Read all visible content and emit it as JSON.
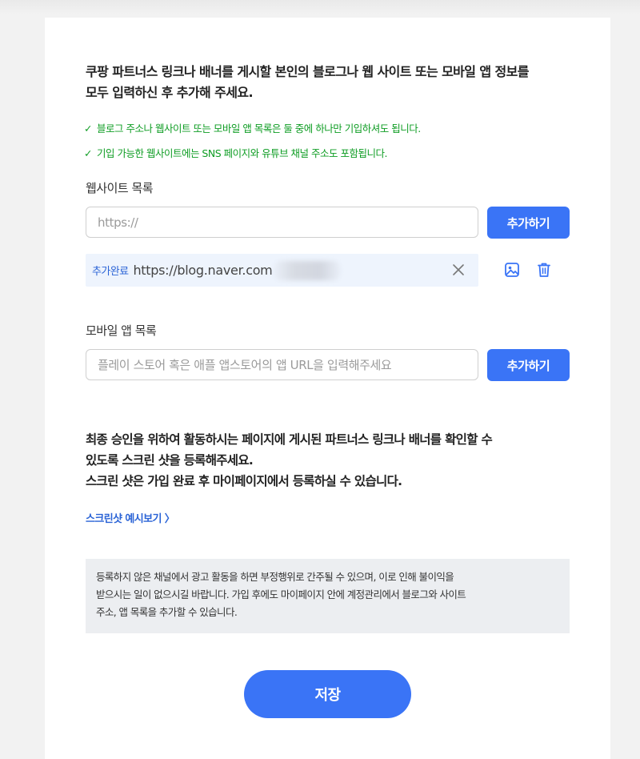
{
  "intro": {
    "line1": "쿠팡 파트너스 링크나 배너를 게시할 본인의 블로그나 웹 사이트 또는 모바일 앱 정보를",
    "line2": "모두 입력하신 후 추가해 주세요."
  },
  "checks": [
    {
      "mark": "✓",
      "text": "블로그 주소나 웹사이트 또는 모바일 앱 목록은 둘 중에 하나만 기입하셔도 됩니다."
    },
    {
      "mark": "✓",
      "text": "기입 가능한 웹사이트에는 SNS 페이지와 유튜브 채널 주소도 포함됩니다."
    }
  ],
  "website": {
    "label": "웹사이트 목록",
    "input_value": "",
    "placeholder": "https://",
    "add_label": "추가하기",
    "added_items": [
      {
        "tag": "추가완료",
        "url": "https://blog.naver.com"
      }
    ]
  },
  "mobile_app": {
    "label": "모바일 앱 목록",
    "input_value": "",
    "placeholder": "플레이 스토어 혹은 애플 앱스토어의 앱 URL을 입력해주세요",
    "add_label": "추가하기"
  },
  "guide": {
    "line1": "최종 승인을 위하여 활동하시는 페이지에 게시된 파트너스 링크나 배너를 확인할 수",
    "line2": "있도록 스크린 샷을 등록해주세요.",
    "line3": "스크린 샷은 가입 완료 후 마이페이지에서 등록하실 수 있습니다.",
    "preview_link": "스크린샷 예시보기 〉"
  },
  "notice": {
    "line1": "등록하지 않은 채널에서 광고 활동을 하면 부정행위로 간주될 수 있으며, 이로 인해 불이익을",
    "line2": "받으시는 일이 없으시길 바랍니다. 가입 후에도 마이페이지 안에 계정관리에서 블로그와 사이트",
    "line3": "주소, 앱 목록을 추가할 수 있습니다."
  },
  "save_label": "저장",
  "colors": {
    "accent": "#3a74f6",
    "check_green": "#0f9d24",
    "link_blue": "#2a63d6",
    "notice_bg": "#eceef1",
    "added_bg": "#eef4fd"
  },
  "icons": {
    "added_row": [
      "close-icon",
      "image-icon",
      "trash-icon"
    ]
  }
}
